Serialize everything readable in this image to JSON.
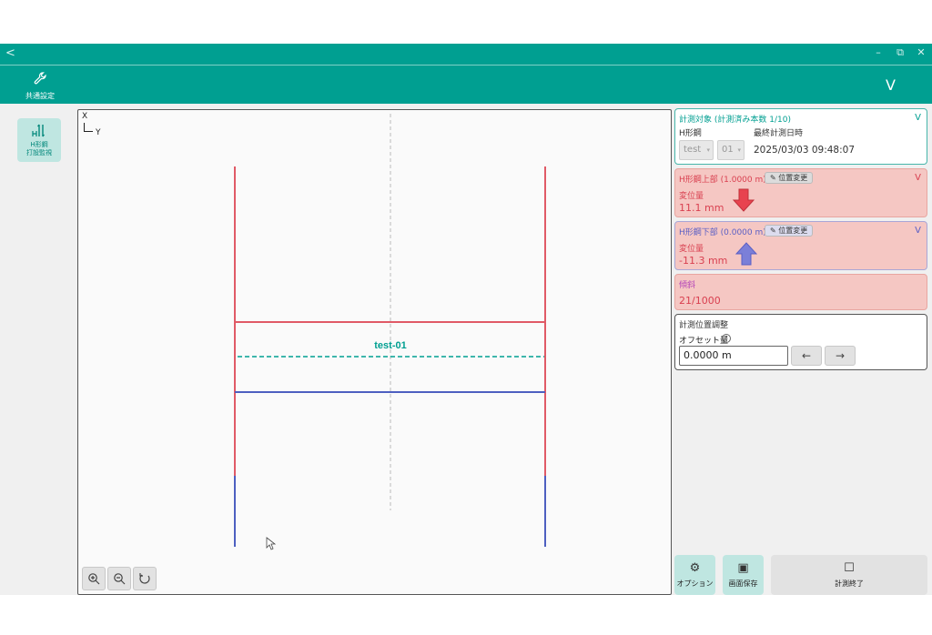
{
  "titlebar": {
    "back": "<",
    "minimize": "–",
    "restore": "⧉",
    "close": "✕"
  },
  "toolbar": {
    "common_settings_label": "共通設定",
    "collapse_label": "V"
  },
  "leftbar": {
    "h_button_line1": "H形鋼",
    "h_button_line2": "打設監視"
  },
  "canvas": {
    "axis_x": "X",
    "axis_y": "Y",
    "member_label": "test-01",
    "colors": {
      "upper": "#e05a66",
      "lower": "#4d5fc0",
      "center": "#009f91",
      "guide": "#bbbbbb"
    }
  },
  "panels": {
    "target": {
      "title": "計測対象 (計測済み本数 1/10)",
      "chevron": "V",
      "h_label": "H形鋼",
      "select1": "test",
      "select2": "01",
      "last_label": "最終計測日時",
      "last_value": "2025/03/03 09:48:07"
    },
    "upper": {
      "title": "H形鋼上部 (1.0000 m)",
      "pos_button": "位置変更",
      "chevron": "V",
      "disp_label": "変位量",
      "disp_value": "11.1 mm",
      "arrow_direction": "down",
      "arrow_color": "#e8434f"
    },
    "lower": {
      "title": "H形鋼下部 (0.0000 m)",
      "pos_button": "位置変更",
      "chevron": "V",
      "disp_label": "変位量",
      "disp_value": "-11.3 mm",
      "arrow_direction": "up",
      "arrow_color": "#7b7fd8"
    },
    "tilt": {
      "title": "傾斜",
      "value": "21/1000"
    },
    "offset": {
      "title": "計測位置調整",
      "label": "オフセット量",
      "help": "?",
      "value": "0.0000 m",
      "left": "←",
      "right": "→"
    }
  },
  "bottom": {
    "options_label": "オプション",
    "save_label": "画面保存",
    "end_label": "計測終了"
  },
  "accent": "#009f91"
}
